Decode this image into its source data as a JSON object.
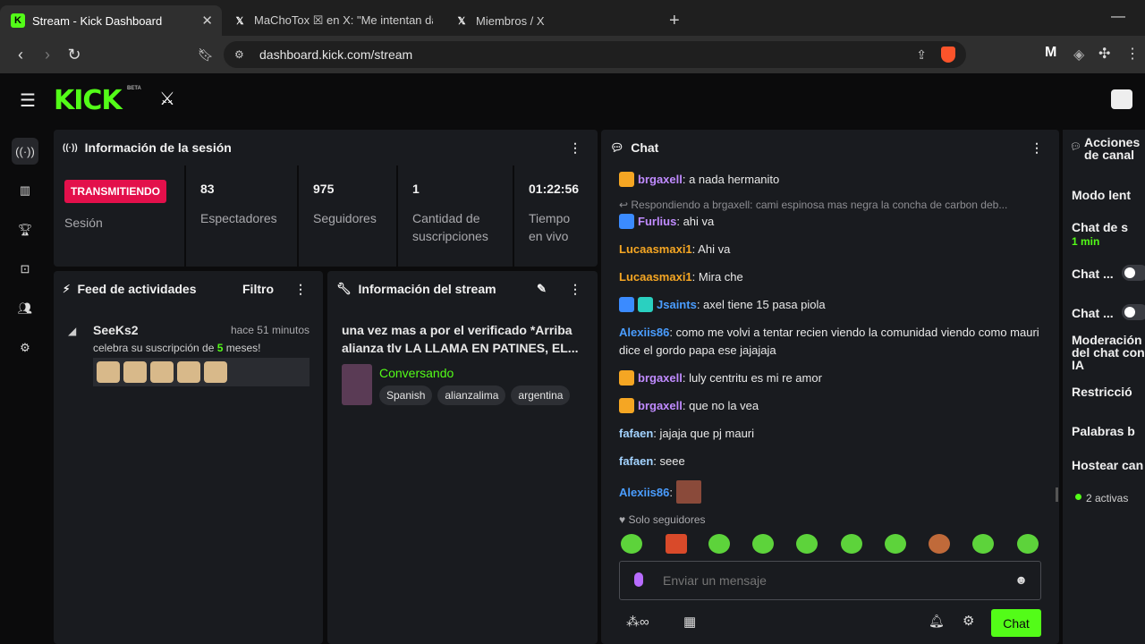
{
  "browser": {
    "tabs": [
      {
        "title": "Stream - Kick Dashboard"
      },
      {
        "title": "MaChoTox ☒ en X: \"Me intentan dar"
      },
      {
        "title": "Miembros / X"
      }
    ],
    "url": "dashboard.kick.com/stream"
  },
  "kick": {
    "logo": "KICK",
    "beta": "BETA"
  },
  "session": {
    "title": "Información de la sesión",
    "status": "TRANSMITIENDO",
    "status_label": "Sesión",
    "stats": [
      {
        "value": "83",
        "label": "Espectadores"
      },
      {
        "value": "975",
        "label": "Seguidores"
      },
      {
        "value": "1",
        "label": "Cantidad de suscripciones"
      },
      {
        "value": "01:22:56",
        "label": "Tiempo en vivo"
      }
    ]
  },
  "feed": {
    "title": "Feed de actividades",
    "filter": "Filtro",
    "user": "SeeKs2",
    "time": "hace 51 minutos",
    "msg_pre": "celebra su suscripción de ",
    "msg_num": "5",
    "msg_post": " meses!"
  },
  "stream_info": {
    "title": "Información del stream",
    "stream_title": "una vez mas a por el verificado *Arriba alianza tlv LA LLAMA EN PATINES, EL...",
    "category": "Conversando",
    "tags": [
      "Spanish",
      "alianzalima",
      "argentina"
    ]
  },
  "chat": {
    "title": "Chat",
    "messages": [
      {
        "user": "brgaxell",
        "text": ": a nada hermanito",
        "color": "#c08bff"
      },
      {
        "reply": "Respondiendo a brgaxell: cami espinosa mas negra la concha de carbon deb..."
      },
      {
        "user": "Furlius",
        "text": ": ahi va",
        "color": "#c08bff"
      },
      {
        "user": "Lucaasmaxi1",
        "text": ": Ahi va",
        "color": "#f5a623"
      },
      {
        "user": "Lucaasmaxi1",
        "text": ": Mira che",
        "color": "#f5a623"
      },
      {
        "user": "Jsaints",
        "text": ": axel tiene 15 pasa piola",
        "color": "#4a9dff"
      },
      {
        "user": "Alexiis86",
        "text": ": como me volvi a tentar recien viendo la comunidad viendo como mauri dice el gordo papa ese jajajaja",
        "color": "#4a9dff"
      },
      {
        "user": "brgaxell",
        "text": ": luly centritu es mi re amor",
        "color": "#c08bff"
      },
      {
        "user": "brgaxell",
        "text": ": que no la vea",
        "color": "#c08bff"
      },
      {
        "user": "fafaen",
        "text": ": jajaja que pj mauri",
        "color": "#a3d3ff"
      },
      {
        "user": "fafaen",
        "text": ": seee",
        "color": "#a3d3ff"
      },
      {
        "user": "Alexiis86",
        "text": ":",
        "color": "#4a9dff"
      }
    ],
    "followers_only": "Solo seguidores",
    "placeholder": "Enviar un mensaje",
    "send": "Chat"
  },
  "actions": {
    "title": "Acciones de canal",
    "items": [
      "Modo lent",
      "Chat de s",
      "1 min",
      "Chat ...",
      "Chat ...",
      "Moderación del chat con IA",
      "Restricció",
      "Palabras b",
      "Hostear can",
      "2 activas"
    ]
  }
}
